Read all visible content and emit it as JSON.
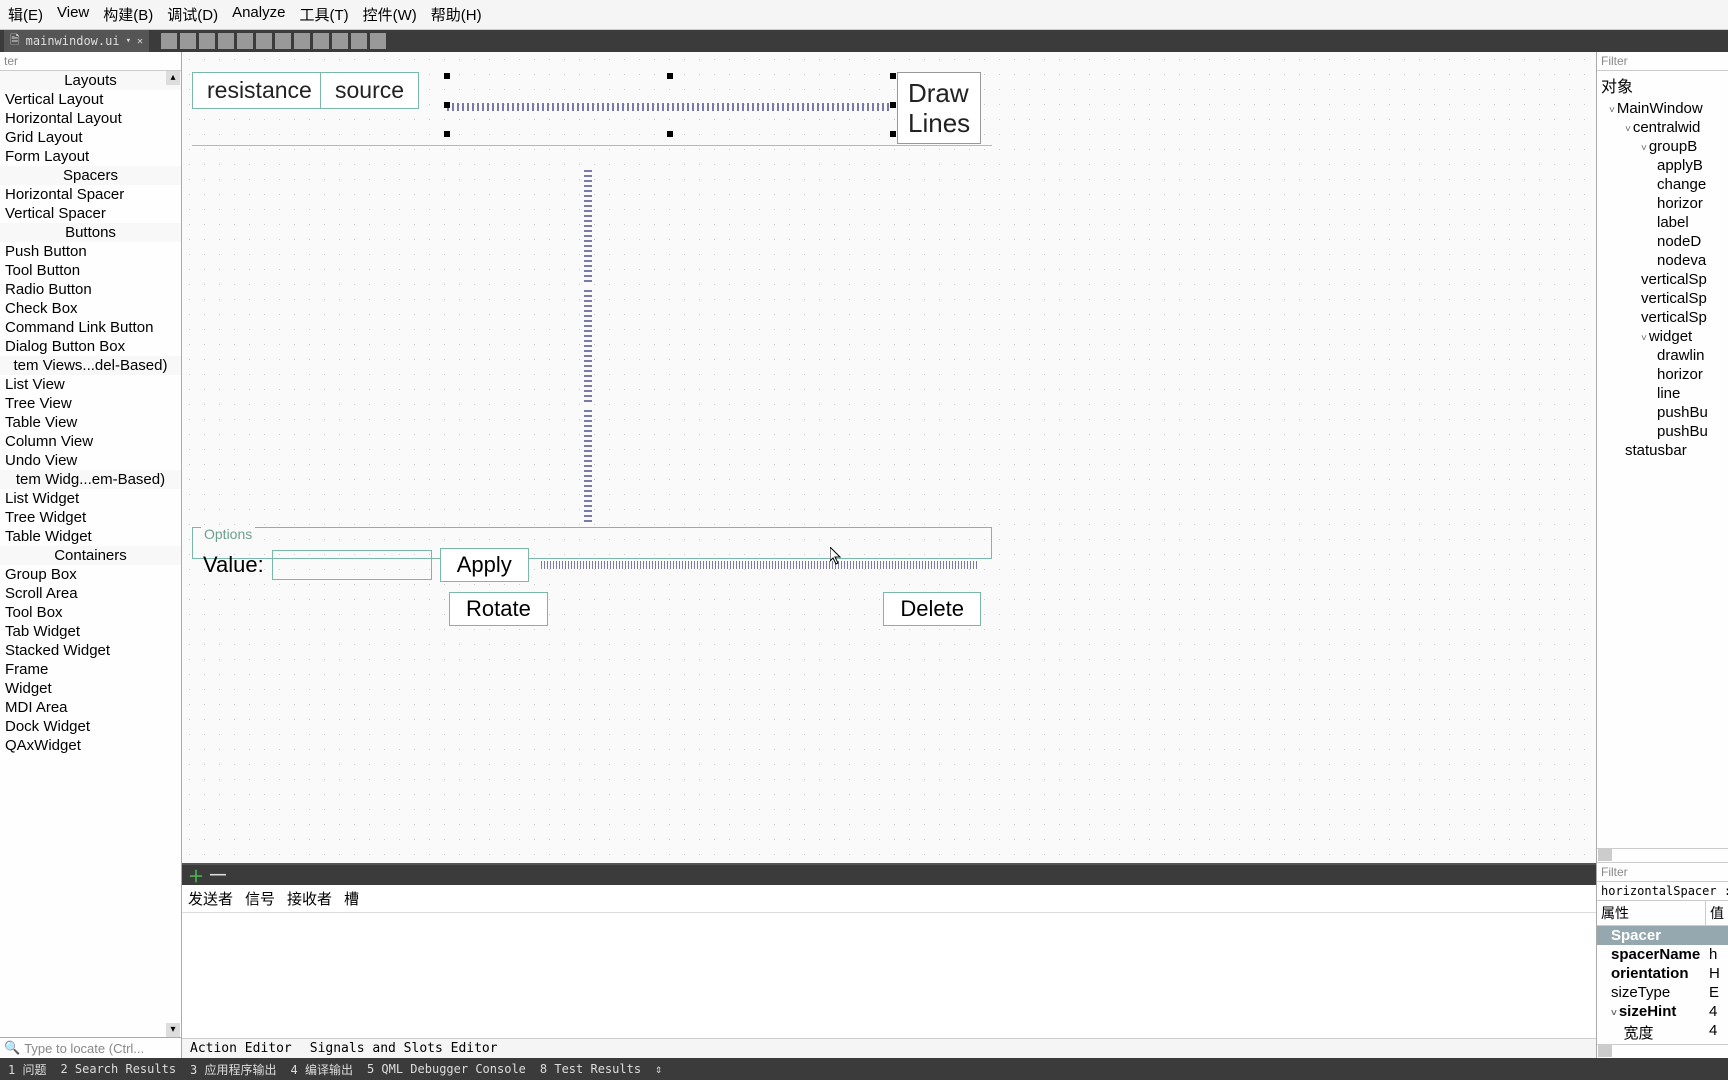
{
  "menubar": [
    "辑(E)",
    "View",
    "构建(B)",
    "调试(D)",
    "Analyze",
    "工具(T)",
    "控件(W)",
    "帮助(H)"
  ],
  "file_tab": "mainwindow.ui",
  "left": {
    "filter_placeholder": "ter",
    "categories": [
      {
        "title": "Layouts",
        "items": [
          "Vertical Layout",
          "Horizontal Layout",
          "Grid Layout",
          "Form Layout"
        ]
      },
      {
        "title": "Spacers",
        "items": [
          "Horizontal Spacer",
          "Vertical Spacer"
        ]
      },
      {
        "title": "Buttons",
        "items": [
          "Push Button",
          "Tool Button",
          "Radio Button",
          "Check Box",
          "Command Link Button",
          "Dialog Button Box"
        ]
      },
      {
        "title": "tem Views...del-Based)",
        "items": [
          "List View",
          "Tree View",
          "Table View",
          "Column View",
          "Undo View"
        ]
      },
      {
        "title": "tem Widg...em-Based)",
        "items": [
          "List Widget",
          "Tree Widget",
          "Table Widget"
        ]
      },
      {
        "title": "Containers",
        "items": [
          "Group Box",
          "Scroll Area",
          "Tool Box",
          "Tab Widget",
          "Stacked Widget",
          "Frame",
          "Widget",
          "MDI Area",
          "Dock Widget",
          "QAxWidget"
        ]
      }
    ],
    "locate_placeholder": "Type to locate (Ctrl..."
  },
  "canvas": {
    "btn_resistance": "resistance",
    "btn_source": "source",
    "btn_drawlines_l1": "Draw",
    "btn_drawlines_l2": "Lines",
    "group_title": "Options",
    "value_label": "Value:",
    "apply_label": "Apply",
    "rotate_label": "Rotate",
    "delete_label": "Delete"
  },
  "bottom": {
    "columns": [
      "发送者",
      "信号",
      "接收者",
      "槽"
    ],
    "tabs": [
      "Action Editor",
      "Signals and Slots Editor"
    ]
  },
  "right": {
    "filter_placeholder": "Filter",
    "title": "对象",
    "tree": [
      {
        "lvl": 1,
        "tw": "˅",
        "label": "MainWindow"
      },
      {
        "lvl": 2,
        "tw": "˅",
        "label": "centralwid"
      },
      {
        "lvl": 3,
        "tw": "˅",
        "label": "groupB"
      },
      {
        "lvl": 4,
        "tw": "",
        "label": "applyB"
      },
      {
        "lvl": 4,
        "tw": "",
        "label": "change"
      },
      {
        "lvl": 4,
        "tw": "",
        "label": "horizor"
      },
      {
        "lvl": 4,
        "tw": "",
        "label": "label"
      },
      {
        "lvl": 4,
        "tw": "",
        "label": "nodeD"
      },
      {
        "lvl": 4,
        "tw": "",
        "label": "nodeva"
      },
      {
        "lvl": 3,
        "tw": "",
        "label": "verticalSp"
      },
      {
        "lvl": 3,
        "tw": "",
        "label": "verticalSp"
      },
      {
        "lvl": 3,
        "tw": "",
        "label": "verticalSp"
      },
      {
        "lvl": 3,
        "tw": "˅",
        "label": "widget"
      },
      {
        "lvl": 4,
        "tw": "",
        "label": "drawlin"
      },
      {
        "lvl": 4,
        "tw": "",
        "label": "horizor"
      },
      {
        "lvl": 4,
        "tw": "",
        "label": "line"
      },
      {
        "lvl": 4,
        "tw": "",
        "label": "pushBu"
      },
      {
        "lvl": 4,
        "tw": "",
        "label": "pushBu"
      },
      {
        "lvl": 2,
        "tw": "",
        "label": "statusbar"
      }
    ],
    "filter2_placeholder": "Filter",
    "objname": "horizontalSpacer : S",
    "prop_header": [
      "属性",
      "值"
    ],
    "props": [
      {
        "cat": true,
        "name": "Spacer",
        "val": ""
      },
      {
        "bold": true,
        "name": "spacerName",
        "val": "h"
      },
      {
        "bold": true,
        "name": "orientation",
        "val": "H"
      },
      {
        "name": "sizeType",
        "val": "E"
      },
      {
        "bold": true,
        "tw": "˅",
        "name": "sizeHint",
        "val": "4"
      },
      {
        "indent": true,
        "name": "宽度",
        "val": "4"
      }
    ]
  },
  "statusbar": [
    "1 问题",
    "2 Search Results",
    "3 应用程序输出",
    "4 编译输出",
    "5 QML Debugger Console",
    "8 Test Results"
  ]
}
